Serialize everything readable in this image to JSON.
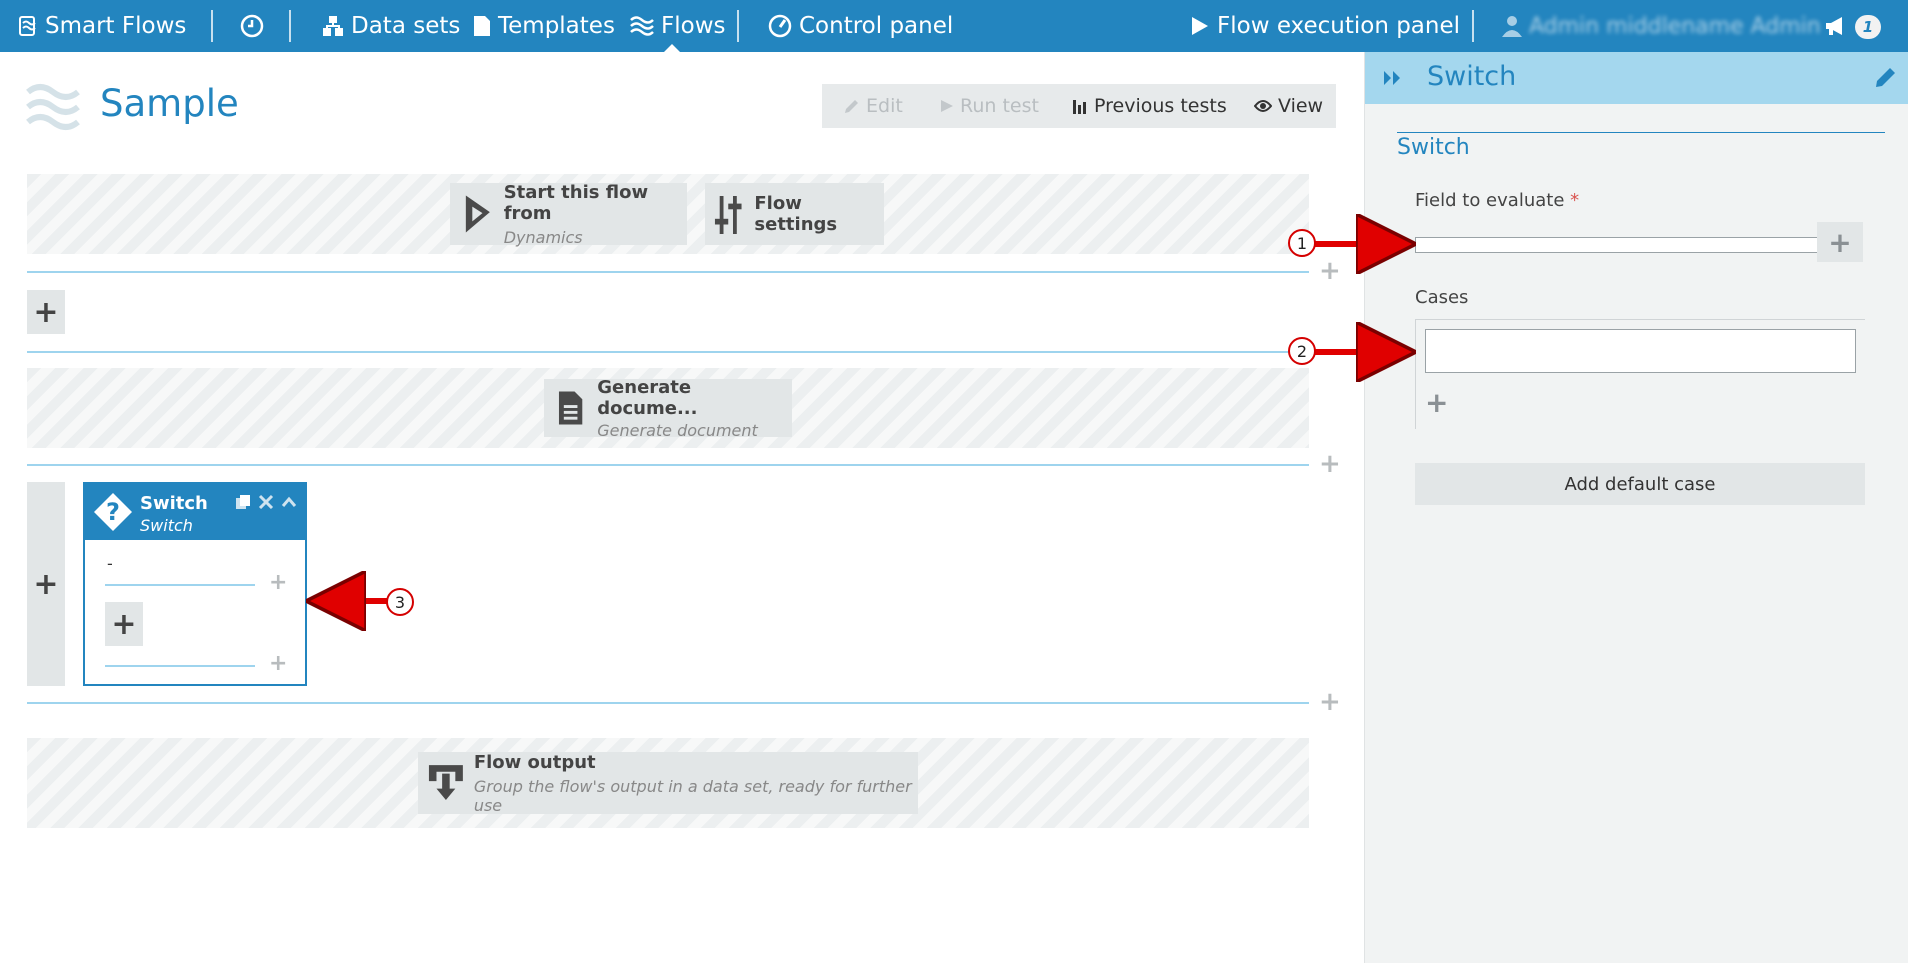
{
  "topbar": {
    "brand": "Smart Flows",
    "history_icon": "clock-icon",
    "nav": [
      {
        "label": "Data sets",
        "icon": "sitemap-icon"
      },
      {
        "label": "Templates",
        "icon": "document-icon"
      },
      {
        "label": "Flows",
        "icon": "waves-icon",
        "active": true
      },
      {
        "label": "Control panel",
        "icon": "gauge-icon"
      }
    ],
    "execution_panel": "Flow execution panel",
    "user": "Admin middlename Admin",
    "notifications_count": "1"
  },
  "page": {
    "title": "Sample",
    "toolbar": {
      "edit": "Edit",
      "run_test": "Run test",
      "previous_tests": "Previous tests",
      "view": "View"
    }
  },
  "flow": {
    "start": {
      "title": "Start this flow from",
      "subtitle": "Dynamics"
    },
    "settings": {
      "title": "Flow settings"
    },
    "generate": {
      "title": "Generate docume...",
      "subtitle": "Generate document"
    },
    "switch": {
      "title": "Switch",
      "subtitle": "Switch",
      "case_value": "-"
    },
    "output": {
      "title": "Flow output",
      "subtitle": "Group the flow's output in a data set, ready for further use"
    }
  },
  "panel": {
    "header_title": "Switch",
    "section_title": "Switch",
    "field_label": "Field to evaluate",
    "required_mark": "*",
    "field_value": "",
    "cases_label": "Cases",
    "case_value": "",
    "default_case_button": "Add default case"
  },
  "annotations": [
    "1",
    "2",
    "3"
  ],
  "colors": {
    "brand_blue": "#2385bf",
    "panel_header": "#a4d7ee",
    "arrow_red": "#e00000"
  }
}
